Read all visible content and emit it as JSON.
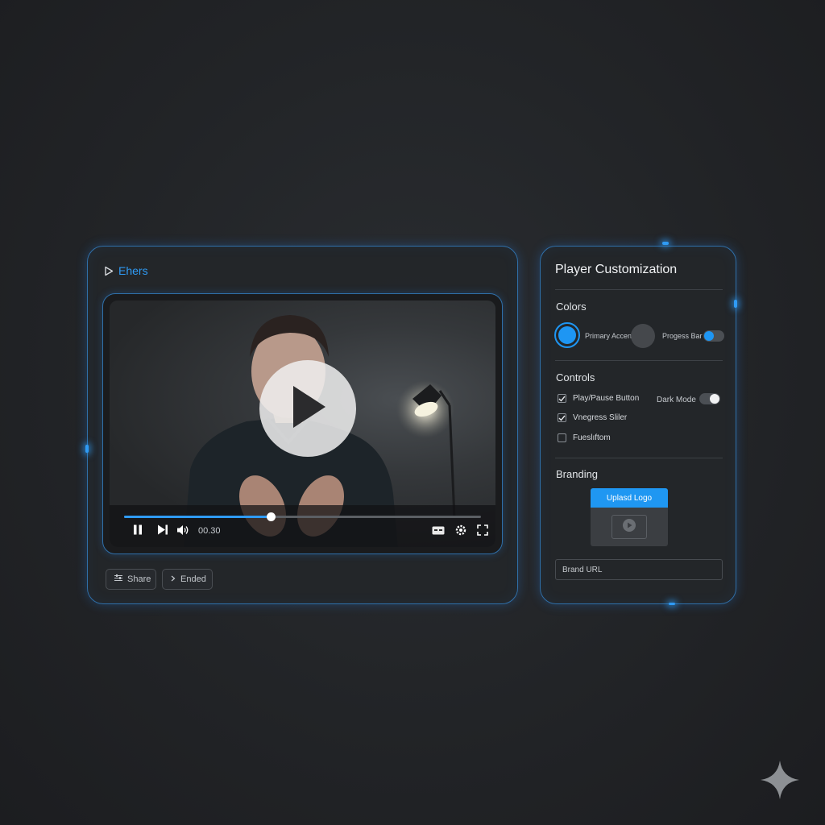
{
  "player": {
    "brand_icon": "play-outline-icon",
    "brand_text": "Ehers",
    "progress_fraction": 0.41,
    "time": "00.30",
    "share_label": "Share",
    "share_icon": "sliders-icon",
    "ended_label": "Ended",
    "ended_icon": "chevron-right-icon",
    "controls": [
      "pause-icon",
      "skip-next-icon",
      "volume-icon",
      "captions-icon",
      "settings-icon",
      "fullscreen-icon"
    ]
  },
  "customization": {
    "title": "Player Customization",
    "colors": {
      "label": "Colors",
      "primary_accent_label": "Primary Accent",
      "primary_accent_color": "#1e96f3",
      "secondary_swatch_color": "#45484c",
      "progress_bar_label": "Progess Bar",
      "progress_bar_on": true
    },
    "controls": {
      "label": "Controls",
      "items": [
        {
          "label": "Play/Pause Button",
          "checked": true
        },
        {
          "label": "Vnegress Sliler",
          "checked": true
        },
        {
          "label": "Fueslıftom",
          "checked": false
        }
      ],
      "dark_mode_label": "Dark Mode",
      "dark_mode_on": true
    },
    "branding": {
      "label": "Branding",
      "upload_label": "Uplasd Logo",
      "preview_icon": "play-circle-icon",
      "url_placeholder": "Brand URL"
    }
  },
  "colors": {
    "accent": "#2f9bf5",
    "panel_border": "#2f6fa8",
    "background": "#222427"
  }
}
